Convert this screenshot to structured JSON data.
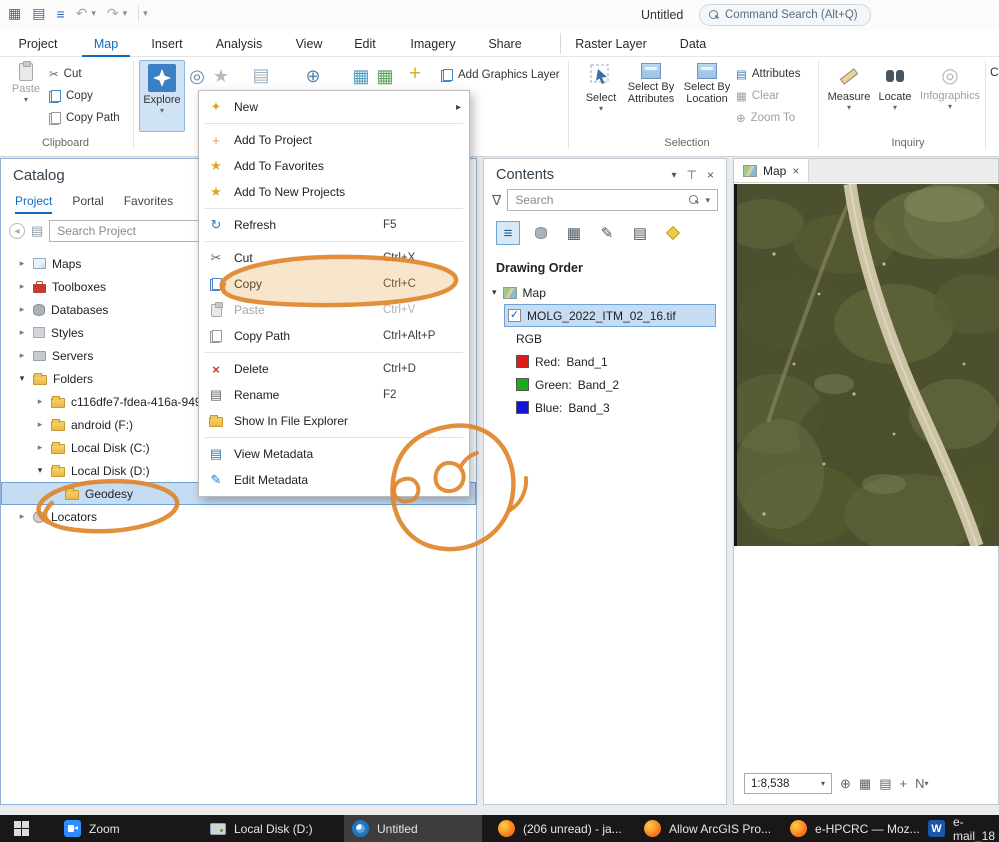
{
  "titlebar": {
    "title": "Untitled",
    "search_placeholder": "Command Search (Alt+Q)"
  },
  "icons": {
    "caret_down": "▾",
    "arrow_right": "▸",
    "arrow_down": "▾",
    "back": "◂",
    "close": "×",
    "check": "✓",
    "undo": "↶",
    "redo": "↷",
    "refresh": "↻",
    "scissors": "✂",
    "star": "★",
    "sparkle": "✦",
    "pencil": "✎",
    "page": "▤",
    "grid": "▦",
    "list": "≡",
    "circle": "◎",
    "target": "⊕",
    "plus": "+",
    "funnel_nabla": "∇",
    "pin": "⊤"
  },
  "ribbon": {
    "tabs": [
      {
        "label": "Project"
      },
      {
        "label": "Map"
      },
      {
        "label": "Insert"
      },
      {
        "label": "Analysis"
      },
      {
        "label": "View"
      },
      {
        "label": "Edit"
      },
      {
        "label": "Imagery"
      },
      {
        "label": "Share"
      },
      {
        "label": "Raster Layer"
      },
      {
        "label": "Data"
      }
    ],
    "clipboard": {
      "group_label": "Clipboard",
      "paste": "Paste",
      "cut": "Cut",
      "copy": "Copy",
      "copy_path": "Copy Path"
    },
    "navigate": {
      "explore": "Explore"
    },
    "layer": {
      "add_graphics_layer": "Add Graphics Layer"
    },
    "selection": {
      "group_label": "Selection",
      "select": "Select",
      "select_by_attributes": "Select By Attributes",
      "select_by_location": "Select By Location",
      "attributes": "Attributes",
      "clear": "Clear",
      "zoom_to": "Zoom To"
    },
    "inquiry": {
      "group_label": "Inquiry",
      "measure": "Measure",
      "locate": "Locate",
      "infographics": "Infographics",
      "clipped_label": "C"
    }
  },
  "catalog": {
    "title": "Catalog",
    "tabs": [
      {
        "label": "Project"
      },
      {
        "label": "Portal"
      },
      {
        "label": "Favorites"
      }
    ],
    "search_placeholder": "Search Project",
    "tree": [
      {
        "label": "Maps"
      },
      {
        "label": "Toolboxes"
      },
      {
        "label": "Databases"
      },
      {
        "label": "Styles"
      },
      {
        "label": "Servers"
      },
      {
        "label": "Folders"
      },
      {
        "label": "c116dfe7-fdea-416a-949"
      },
      {
        "label": "android (F:)"
      },
      {
        "label": "Local Disk (C:)"
      },
      {
        "label": "Local Disk (D:)"
      },
      {
        "label": "Geodesy"
      },
      {
        "label": "Locators"
      }
    ]
  },
  "context_menu": {
    "items": [
      {
        "label": "New",
        "shortcut": ""
      },
      {
        "label": "Add To Project",
        "shortcut": ""
      },
      {
        "label": "Add To Favorites",
        "shortcut": ""
      },
      {
        "label": "Add To New Projects",
        "shortcut": ""
      },
      {
        "label": "Refresh",
        "shortcut": "F5"
      },
      {
        "label": "Cut",
        "shortcut": "Ctrl+X"
      },
      {
        "label": "Copy",
        "shortcut": "Ctrl+C"
      },
      {
        "label": "Paste",
        "shortcut": "Ctrl+V"
      },
      {
        "label": "Copy Path",
        "shortcut": "Ctrl+Alt+P"
      },
      {
        "label": "Delete",
        "shortcut": "Ctrl+D"
      },
      {
        "label": "Rename",
        "shortcut": "F2"
      },
      {
        "label": "Show In File Explorer",
        "shortcut": ""
      },
      {
        "label": "View Metadata",
        "shortcut": ""
      },
      {
        "label": "Edit Metadata",
        "shortcut": ""
      }
    ]
  },
  "contents": {
    "title": "Contents",
    "search_placeholder": "Search",
    "drawing_order_label": "Drawing Order",
    "map_node_label": "Map",
    "layer_name": "MOLG_2022_ITM_02_16.tif",
    "legend_heading": "RGB",
    "legend": [
      {
        "channel": "Red:",
        "band": "Band_1",
        "color": "#e01b1b"
      },
      {
        "channel": "Green:",
        "band": "Band_2",
        "color": "#1daa1d"
      },
      {
        "channel": "Blue:",
        "band": "Band_3",
        "color": "#1515d8"
      }
    ]
  },
  "map_view": {
    "tab_label": "Map",
    "scale": "1:8,538",
    "north_label": "N"
  },
  "taskbar": {
    "items": [
      {
        "label": "Zoom"
      },
      {
        "label": "Local Disk (D:)"
      },
      {
        "label": "Untitled"
      },
      {
        "label": "(206 unread) - ja..."
      },
      {
        "label": "Allow ArcGIS Pro..."
      },
      {
        "label": "e-HPCRC — Moz..."
      },
      {
        "label": "e-mail_18"
      }
    ]
  },
  "colors": {
    "accent": "#0f6cbd",
    "annotation": "#e0862c",
    "selection": "#c5dcf3"
  }
}
